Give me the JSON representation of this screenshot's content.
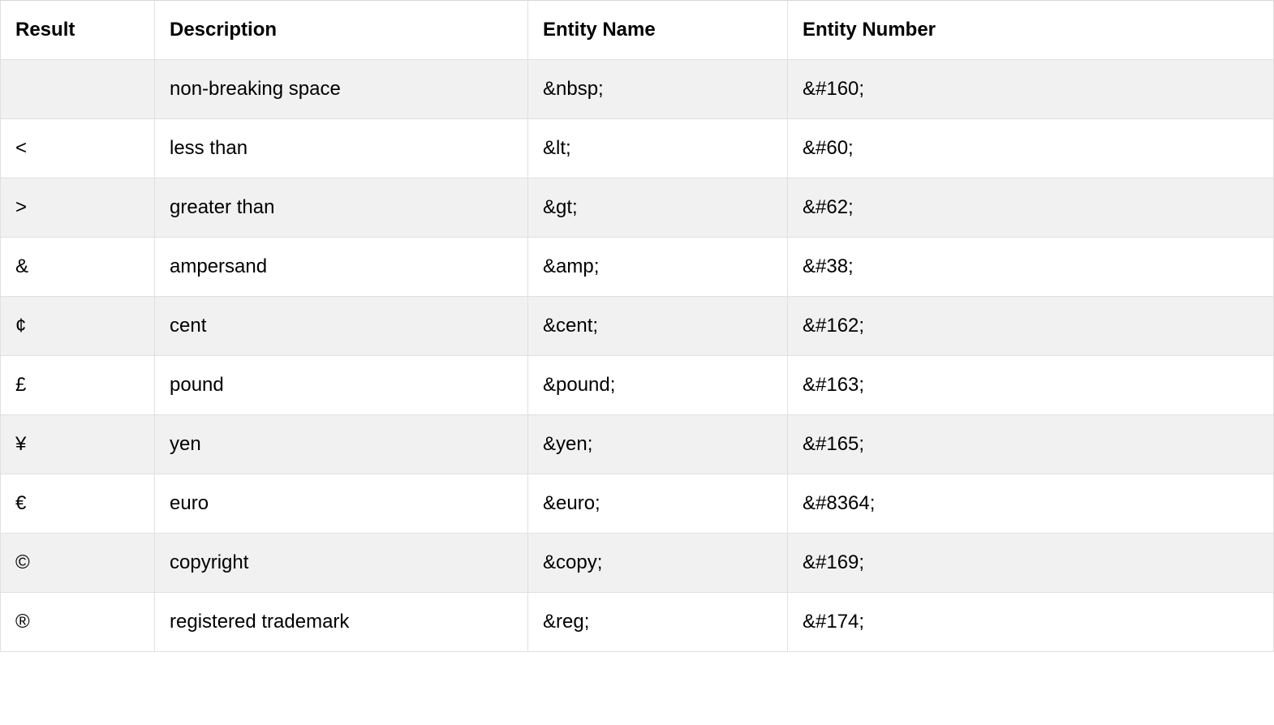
{
  "headers": [
    "Result",
    "Description",
    "Entity Name",
    "Entity Number"
  ],
  "rows": [
    {
      "result": " ",
      "description": "non-breaking space",
      "entity_name": "&nbsp;",
      "entity_number": "&#160;"
    },
    {
      "result": "<",
      "description": "less than",
      "entity_name": "&lt;",
      "entity_number": "&#60;"
    },
    {
      "result": ">",
      "description": "greater than",
      "entity_name": "&gt;",
      "entity_number": "&#62;"
    },
    {
      "result": "&",
      "description": "ampersand",
      "entity_name": "&amp;",
      "entity_number": "&#38;"
    },
    {
      "result": "¢",
      "description": "cent",
      "entity_name": "&cent;",
      "entity_number": "&#162;"
    },
    {
      "result": "£",
      "description": "pound",
      "entity_name": "&pound;",
      "entity_number": "&#163;"
    },
    {
      "result": "¥",
      "description": "yen",
      "entity_name": "&yen;",
      "entity_number": "&#165;"
    },
    {
      "result": "€",
      "description": "euro",
      "entity_name": "&euro;",
      "entity_number": "&#8364;"
    },
    {
      "result": "©",
      "description": "copyright",
      "entity_name": "&copy;",
      "entity_number": "&#169;"
    },
    {
      "result": "®",
      "description": "registered trademark",
      "entity_name": "&reg;",
      "entity_number": "&#174;"
    }
  ]
}
